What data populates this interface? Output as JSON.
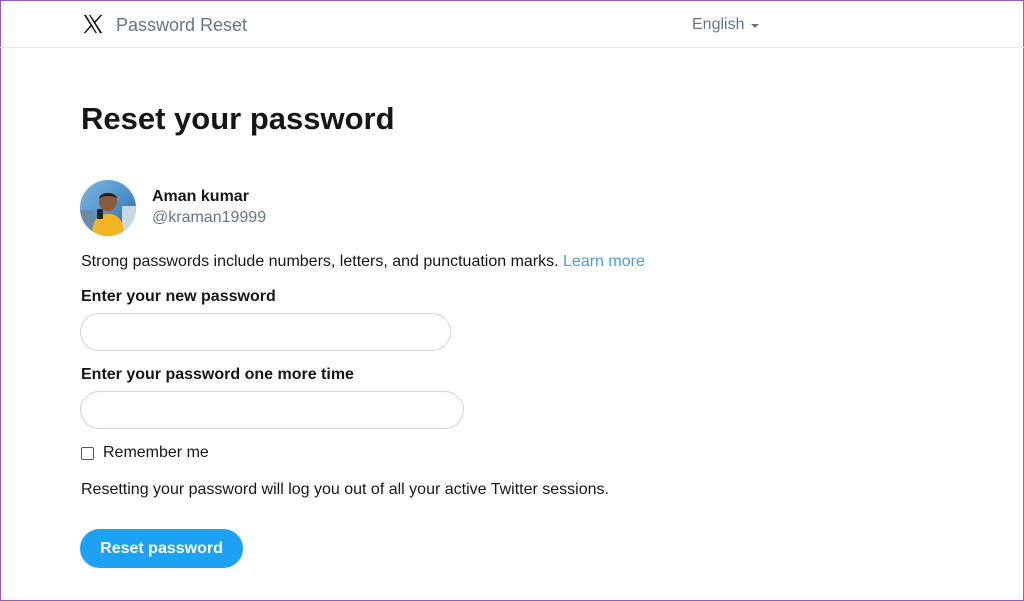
{
  "header": {
    "app_title": "Password Reset",
    "logo_icon": "x-logo-icon",
    "language": "English",
    "language_icon": "caret-down-icon"
  },
  "main": {
    "title": "Reset your password",
    "user": {
      "name": "Aman kumar",
      "handle": "@kraman19999",
      "avatar_icon": "user-avatar"
    },
    "hint_text": "Strong passwords include numbers, letters, and punctuation marks.",
    "learn_more": "Learn more",
    "new_password_label": "Enter your new password",
    "new_password_value": "",
    "confirm_password_label": "Enter your password one more time",
    "confirm_password_value": "",
    "remember_me_label": "Remember me",
    "remember_me_checked": false,
    "notice": "Resetting your password will log you out of all your active Twitter sessions.",
    "reset_button": "Reset password"
  },
  "colors": {
    "accent": "#1da1f2",
    "link": "#4a9fd5",
    "muted_text": "#657786",
    "border": "#ccd6dd"
  }
}
